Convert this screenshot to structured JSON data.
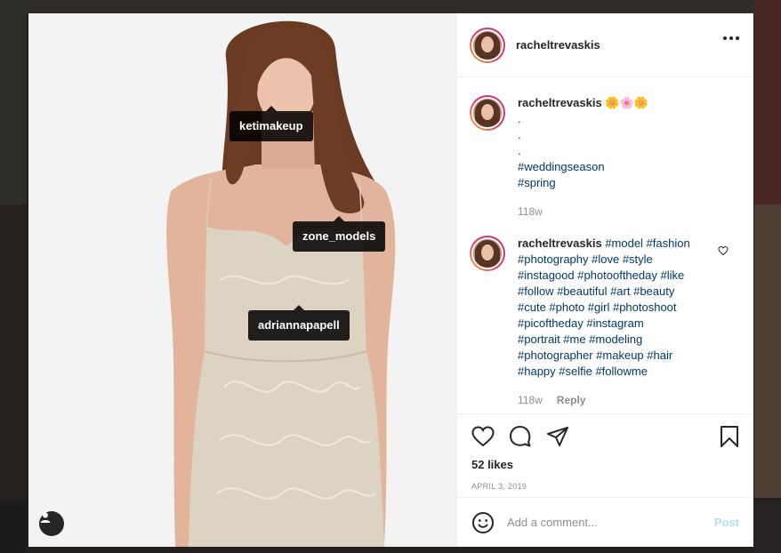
{
  "post": {
    "username": "racheltrevaskis",
    "photo_tags": [
      "ketimakeup",
      "zone_models",
      "adriannapapell"
    ]
  },
  "comments": [
    {
      "username": "racheltrevaskis",
      "emoji": "🌼🌸🌼",
      "lines": [
        ".",
        ".",
        "."
      ],
      "hashtags_lines": [
        "#weddingseason",
        "#spring"
      ],
      "time": "118w"
    },
    {
      "username": "racheltrevaskis",
      "text_lines": [
        "#model #fashion",
        "#photography #love #style",
        "#instagood #photooftheday #like",
        "#follow #beautiful #art #beauty",
        "#cute #photo #girl #photoshoot",
        "#picoftheday #instagram",
        "#portrait #me #modeling",
        "#photographer #makeup #hair",
        "#happy #selfie #followme"
      ],
      "time": "118w",
      "reply_label": "Reply"
    }
  ],
  "likes": "52 likes",
  "date": "APRIL 3, 2019",
  "add_comment": {
    "placeholder": "Add a comment...",
    "post_label": "Post"
  },
  "icons": [
    "more-options-icon",
    "like-heart-icon",
    "comment-icon",
    "share-icon",
    "bookmark-icon",
    "emoji-icon",
    "user-tags-icon",
    "comment-like-icon"
  ],
  "colors": {
    "hashtag": "#00376b",
    "post_disabled": "#b3dbff",
    "tag_background": "#000000"
  }
}
